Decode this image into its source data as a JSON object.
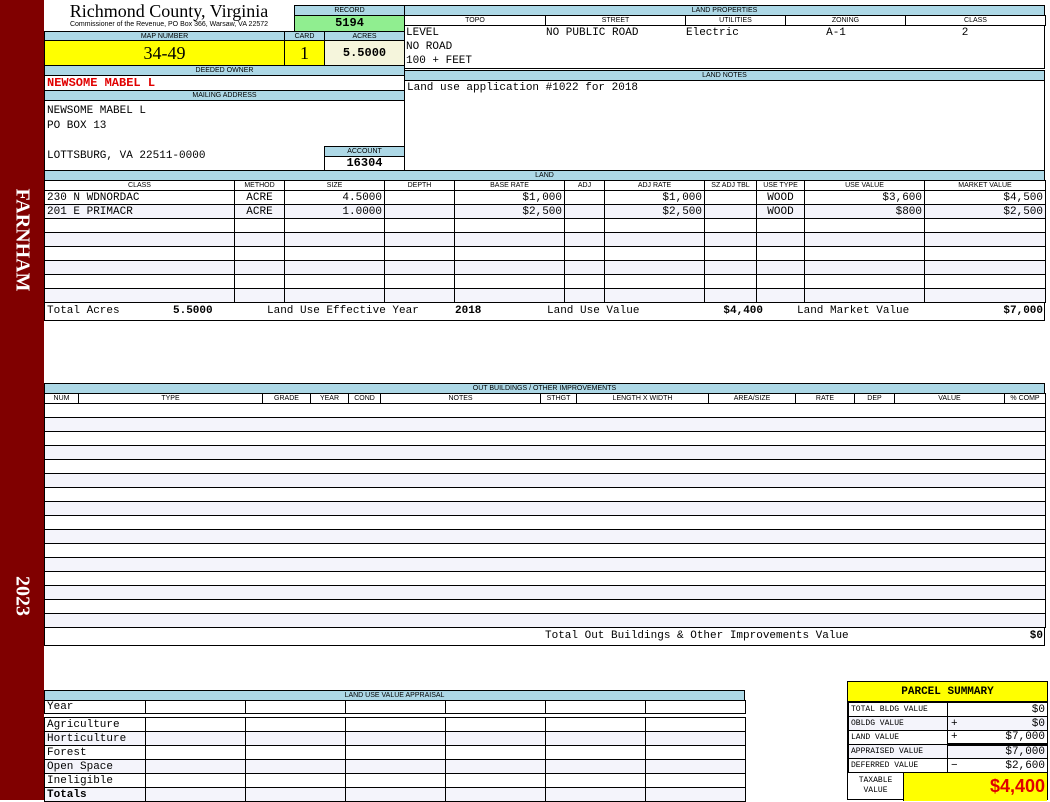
{
  "sidebar": {
    "district": "FARNHAM",
    "year": "2023",
    "color": "#800000"
  },
  "header": {
    "title": "Richmond County, Virginia",
    "subtitle": "Commissioner of the Revenue, PO Box 366, Warsaw, VA 22572"
  },
  "record": {
    "label": "RECORD",
    "value": "5194"
  },
  "map": {
    "label": "MAP NUMBER",
    "value": "34-49"
  },
  "card": {
    "label": "CARD",
    "value": "1"
  },
  "acres": {
    "label": "ACRES",
    "value": "5.5000"
  },
  "owner": {
    "label": "DEEDED OWNER",
    "value": "NEWSOME MABEL L"
  },
  "mailing": {
    "label": "MAILING ADDRESS",
    "line1": "NEWSOME MABEL L",
    "line2": "PO BOX 13",
    "line3": "LOTTSBURG, VA 22511-0000"
  },
  "account": {
    "label": "ACCOUNT",
    "value": "16304"
  },
  "land_properties": {
    "label": "LAND PROPERTIES",
    "headers": [
      "TOPO",
      "STREET",
      "UTILITIES",
      "ZONING",
      "CLASS"
    ],
    "topo": [
      "LEVEL",
      "NO ROAD",
      "100 + FEET"
    ],
    "street": "NO PUBLIC ROAD",
    "utilities": "Electric",
    "zoning": "A-1",
    "class": "2"
  },
  "land_notes": {
    "label": "LAND NOTES",
    "text": "Land use application #1022 for 2018"
  },
  "land": {
    "label": "LAND",
    "headers": [
      "CLASS",
      "METHOD",
      "SIZE",
      "DEPTH",
      "BASE RATE",
      "ADJ",
      "ADJ RATE",
      "SZ ADJ TBL",
      "USE TYPE",
      "USE VALUE",
      "MARKET VALUE"
    ],
    "rows": [
      [
        "230 N WDNORDAC",
        "ACRE",
        "4.5000",
        "",
        "$1,000",
        "",
        "$1,000",
        "",
        "WOOD",
        "$3,600",
        "$4,500"
      ],
      [
        "201 E PRIMACR",
        "ACRE",
        "1.0000",
        "",
        "$2,500",
        "",
        "$2,500",
        "",
        "WOOD",
        "$800",
        "$2,500"
      ]
    ],
    "totals": {
      "acres_label": "Total Acres",
      "acres": "5.5000",
      "year_label": "Land Use Effective Year",
      "year": "2018",
      "use_label": "Land Use Value",
      "use": "$4,400",
      "market_label": "Land Market Value",
      "market": "$7,000"
    }
  },
  "outbuildings": {
    "label": "OUT BUILDINGS / OTHER IMPROVEMENTS",
    "headers": [
      "NUM",
      "TYPE",
      "GRADE",
      "YEAR",
      "COND",
      "NOTES",
      "STHGT",
      "LENGTH X WIDTH",
      "AREA/SIZE",
      "RATE",
      "DEP",
      "VALUE",
      "% COMP"
    ],
    "total_label": "Total Out Buildings & Other Improvements Value",
    "total": "$0"
  },
  "land_use": {
    "label": "LAND USE VALUE APPRAISAL",
    "year_label": "Year",
    "rows": [
      "Agriculture",
      "Horticulture",
      "Forest",
      "Open Space",
      "Ineligible"
    ],
    "totals_label": "Totals"
  },
  "parcel_summary": {
    "title": "PARCEL SUMMARY",
    "rows": [
      {
        "label": "TOTAL BLDG VALUE",
        "sign": "",
        "value": "$0"
      },
      {
        "label": "OBLDG VALUE",
        "sign": "+",
        "value": "$0"
      },
      {
        "label": "LAND VALUE",
        "sign": "+",
        "value": "$7,000"
      },
      {
        "label": "APPRAISED VALUE",
        "sign": "",
        "value": "$7,000"
      },
      {
        "label": "DEFERRED VALUE",
        "sign": "−",
        "value": "$2,600"
      }
    ],
    "taxable_label": "TAXABLE VALUE",
    "taxable": "$4,400"
  }
}
